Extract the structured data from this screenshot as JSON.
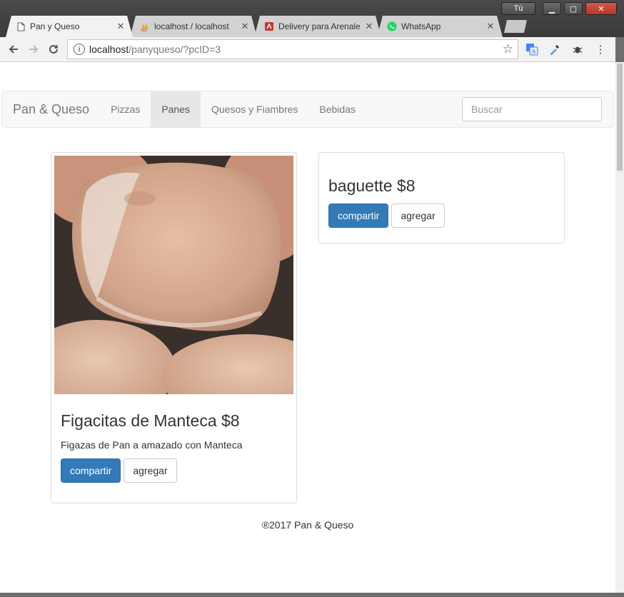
{
  "browser": {
    "tabs": [
      {
        "label": "Pan y Queso",
        "icon": "document-icon",
        "active": true
      },
      {
        "label": "localhost / localhost",
        "icon": "phpmyadmin-icon",
        "active": false
      },
      {
        "label": "Delivery para Arenales",
        "icon": "delivery-icon",
        "active": false
      },
      {
        "label": "WhatsApp",
        "icon": "whatsapp-icon",
        "active": false
      }
    ],
    "user_label": "Tú",
    "url_host": "localhost",
    "url_path": "/panyqueso/?pcID=3"
  },
  "navbar": {
    "brand": "Pan & Queso",
    "links": [
      {
        "label": "Pizzas",
        "active": false
      },
      {
        "label": "Panes",
        "active": true
      },
      {
        "label": "Quesos y Fiambres",
        "active": false
      },
      {
        "label": "Bebidas",
        "active": false
      }
    ],
    "search_placeholder": "Buscar"
  },
  "products": [
    {
      "title": "Figacitas de Manteca $8",
      "description": "Figazas de Pan a amazado con Manteca",
      "share_label": "compartir",
      "add_label": "agregar",
      "has_image": true
    },
    {
      "title": "baguette $8",
      "share_label": "compartir",
      "add_label": "agregar",
      "has_image": false
    }
  ],
  "footer": "®2017 Pan & Queso",
  "colors": {
    "primary": "#337ab7",
    "navbar_bg": "#f8f8f8",
    "active_link_bg": "#e7e7e7"
  }
}
